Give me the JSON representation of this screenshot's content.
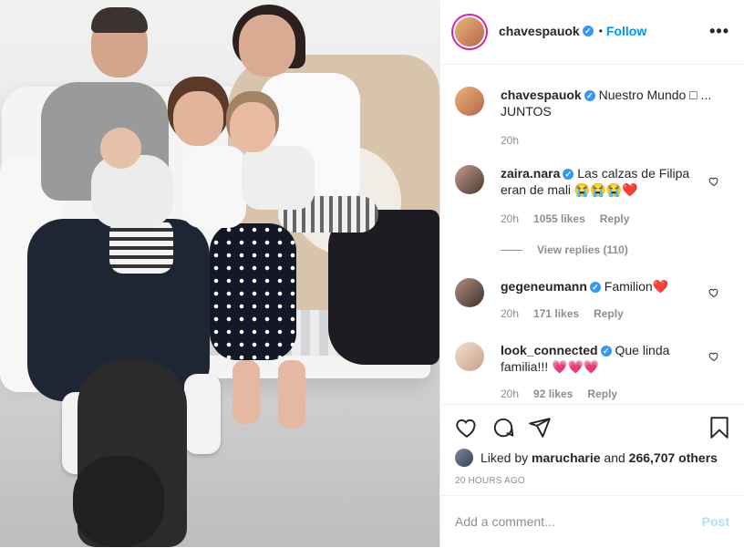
{
  "post": {
    "author": "chavespauok",
    "follow_label": "Follow",
    "dot_separator": "•",
    "more_label": "•••"
  },
  "caption": {
    "author": "chavespauok",
    "text": "Nuestro Mundo □ ... JUNTOS",
    "time": "20h"
  },
  "comments": [
    {
      "author": "zaira.nara",
      "text": "Las calzas de Filipa eran de mali 😭😭😭❤️",
      "time": "20h",
      "likes": "1055 likes",
      "reply_label": "Reply",
      "view_replies": "View replies (110)"
    },
    {
      "author": "gegeneumann",
      "text": "Familion❤️",
      "time": "20h",
      "likes": "171 likes",
      "reply_label": "Reply"
    },
    {
      "author": "look_connected",
      "text": "Que linda familia!!! 💗💗💗",
      "time": "20h",
      "likes": "92 likes",
      "reply_label": "Reply"
    }
  ],
  "likes": {
    "prefix": "Liked by",
    "user": "marucharie",
    "middle": "and",
    "count": "266,707 others"
  },
  "time_ago": "20 HOURS AGO",
  "comment_input": {
    "placeholder": "Add a comment...",
    "post_label": "Post"
  },
  "icons": {
    "like": "heart-icon",
    "comment": "comment-icon",
    "share": "share-icon",
    "save": "bookmark-icon",
    "verified": "verified-badge-icon"
  },
  "colors": {
    "accent": "#0095f6",
    "verified": "#3897f0",
    "muted": "#8e8e8e",
    "post_disabled": "#b2dffc"
  }
}
